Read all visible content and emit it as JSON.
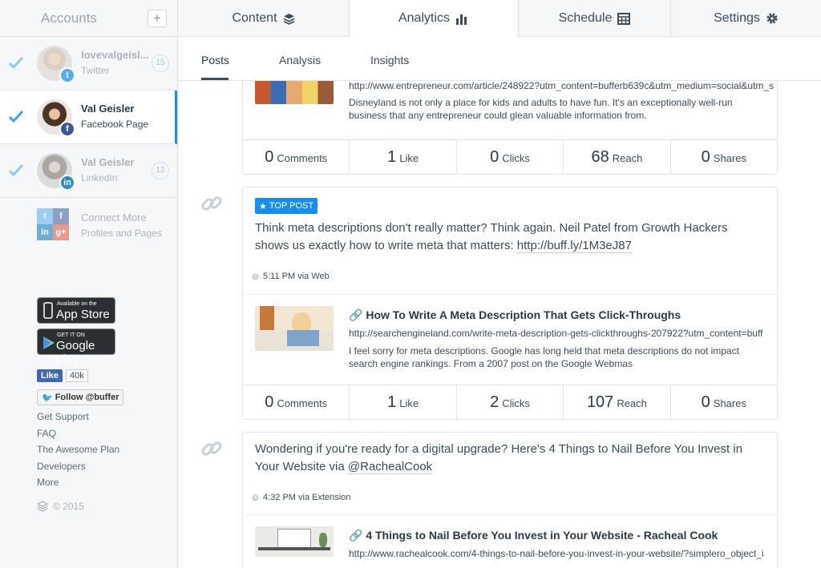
{
  "sidebar": {
    "title": "Accounts",
    "add_label": "+",
    "accounts": [
      {
        "name": "lovevalgeisl...",
        "type": "Twitter",
        "count": "15"
      },
      {
        "name": "Val Geisler",
        "type": "Facebook Page"
      },
      {
        "name": "Val Geisler",
        "type": "LinkedIn",
        "count": "12"
      }
    ],
    "connect": {
      "line1": "Connect More",
      "line2": "Profiles and Pages"
    },
    "app_store": {
      "small": "Available on the",
      "big": "App Store"
    },
    "google_play": {
      "small": "GET IT ON",
      "big": "Google play"
    },
    "like": {
      "label": "Like",
      "count": "40k"
    },
    "follow": {
      "label": "Follow @buffer"
    },
    "links": [
      "Get Support",
      "FAQ",
      "The Awesome Plan",
      "Developers",
      "More"
    ],
    "copyright": "© 2015"
  },
  "tabs": {
    "content": "Content",
    "analytics": "Analytics",
    "schedule": "Schedule",
    "settings": "Settings"
  },
  "subtabs": {
    "posts": "Posts",
    "analysis": "Analysis",
    "insights": "Insights"
  },
  "posts": [
    {
      "preview": {
        "url": "http://www.entrepreneur.com/article/248922?utm_content=bufferb639c&utm_medium=social&utm_s",
        "desc": "Disneyland is not only a place for kids and adults to have fun. It's an exceptionally well-run business that any entrepreneur could glean valuable information from."
      },
      "stats": {
        "comments": "0",
        "comments_lbl": "Comments",
        "likes": "1",
        "likes_lbl": "Like",
        "clicks": "0",
        "clicks_lbl": "Clicks",
        "reach": "68",
        "reach_lbl": "Reach",
        "shares": "0",
        "shares_lbl": "Shares"
      }
    },
    {
      "badge": "TOP POST",
      "text": "Think meta descriptions don't really matter? Think again. Neil Patel from Growth Hackers shows us exactly how to write meta that matters: ",
      "text_url": "http://buff.ly/1M3eJ87",
      "meta": "5:11 PM via Web",
      "preview": {
        "title": "How To Write A Meta Description That Gets Click-Throughs",
        "url": "http://searchengineland.com/write-meta-description-gets-clickthroughs-207922?utm_content=buff",
        "desc": "I feel sorry for meta descriptions. Google has long held that meta descriptions do not impact search engine rankings. From a 2007 post on the Google Webmas"
      },
      "stats": {
        "comments": "0",
        "comments_lbl": "Comments",
        "likes": "1",
        "likes_lbl": "Like",
        "clicks": "2",
        "clicks_lbl": "Clicks",
        "reach": "107",
        "reach_lbl": "Reach",
        "shares": "0",
        "shares_lbl": "Shares"
      }
    },
    {
      "text": "Wondering if you're ready for a digital upgrade? Here's 4 Things to Nail Before You Invest in Your Website via ",
      "text_url": "@RachealCook",
      "meta": "4:32 PM via Extension",
      "preview": {
        "title": "4 Things to Nail Before You Invest in Your Website - Racheal Cook",
        "url": "http://www.rachealcook.com/4-things-to-nail-before-you-invest-in-your-website/?simplero_object_i"
      }
    }
  ],
  "colors": {
    "accent": "#168eea",
    "twitter": "#55acee",
    "facebook": "#3b5998",
    "linkedin": "#0077b5",
    "gplus": "#dd4b39"
  }
}
